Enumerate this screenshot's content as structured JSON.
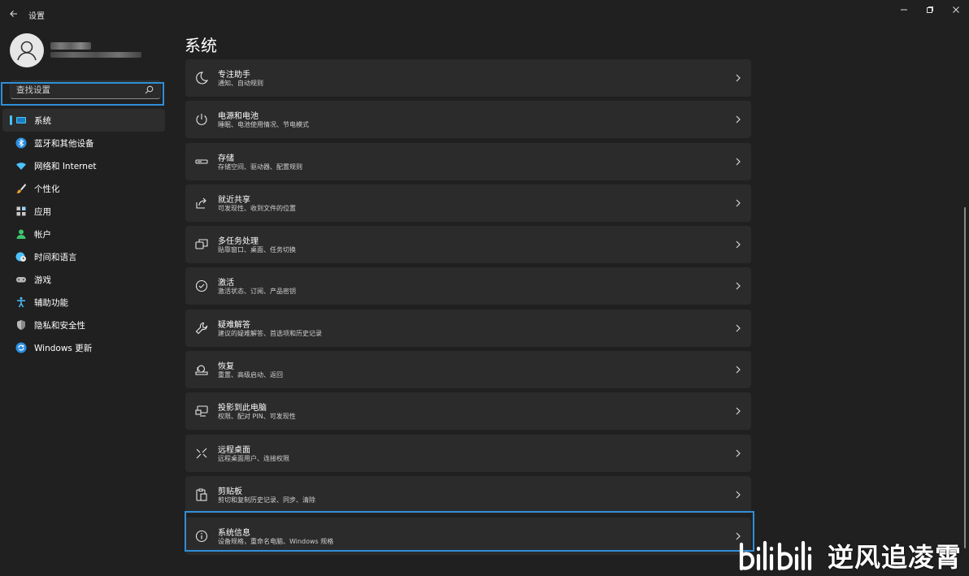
{
  "window": {
    "title": "设置",
    "back_icon": "back-arrow-icon",
    "controls": [
      "minimize-icon",
      "restore-icon",
      "close-icon"
    ]
  },
  "user": {
    "avatar_icon": "user-avatar-icon",
    "name_redacted": true,
    "email_redacted": true
  },
  "search": {
    "placeholder": "查找设置",
    "icon": "search-icon"
  },
  "sidebar": {
    "items": [
      {
        "label": "系统",
        "icon": "monitor-icon",
        "active": true
      },
      {
        "label": "蓝牙和其他设备",
        "icon": "bluetooth-icon"
      },
      {
        "label": "网络和 Internet",
        "icon": "wifi-icon"
      },
      {
        "label": "个性化",
        "icon": "brush-icon"
      },
      {
        "label": "应用",
        "icon": "apps-icon"
      },
      {
        "label": "帐户",
        "icon": "account-icon"
      },
      {
        "label": "时间和语言",
        "icon": "globe-clock-icon"
      },
      {
        "label": "游戏",
        "icon": "gamepad-icon"
      },
      {
        "label": "辅助功能",
        "icon": "accessibility-icon"
      },
      {
        "label": "隐私和安全性",
        "icon": "shield-icon"
      },
      {
        "label": "Windows 更新",
        "icon": "update-icon"
      }
    ]
  },
  "main": {
    "title": "系统",
    "cards": [
      {
        "title": "专注助手",
        "subtitle": "通知、自动规则",
        "icon": "moon-icon"
      },
      {
        "title": "电源和电池",
        "subtitle": "睡眠、电池使用情况、节电模式",
        "icon": "power-icon"
      },
      {
        "title": "存储",
        "subtitle": "存储空间、驱动器、配置规则",
        "icon": "storage-icon"
      },
      {
        "title": "就近共享",
        "subtitle": "可发现性、收到文件的位置",
        "icon": "share-icon"
      },
      {
        "title": "多任务处理",
        "subtitle": "贴靠窗口、桌面、任务切换",
        "icon": "multitask-icon"
      },
      {
        "title": "激活",
        "subtitle": "激活状态、订阅、产品密钥",
        "icon": "check-circle-icon"
      },
      {
        "title": "疑难解答",
        "subtitle": "建议的疑难解答、首选项和历史记录",
        "icon": "wrench-icon"
      },
      {
        "title": "恢复",
        "subtitle": "重置、高级启动、返回",
        "icon": "recovery-icon"
      },
      {
        "title": "投影到此电脑",
        "subtitle": "权限、配对 PIN、可发现性",
        "icon": "projection-icon"
      },
      {
        "title": "远程桌面",
        "subtitle": "远程桌面用户、连接权限",
        "icon": "remote-desktop-icon"
      },
      {
        "title": "剪贴板",
        "subtitle": "剪切和复制历史记录、同步、清除",
        "icon": "clipboard-icon"
      },
      {
        "title": "系统信息",
        "subtitle": "设备规格，重命名电脑、Windows 规格",
        "icon": "info-icon",
        "highlighted": true
      }
    ]
  },
  "watermark": {
    "logo": "bilibili",
    "text": "逆风追凌霄"
  },
  "colors": {
    "background": "#202020",
    "card": "#2b2b2b",
    "accent": "#4cc2ff",
    "highlight_border": "#2f8fd8"
  }
}
